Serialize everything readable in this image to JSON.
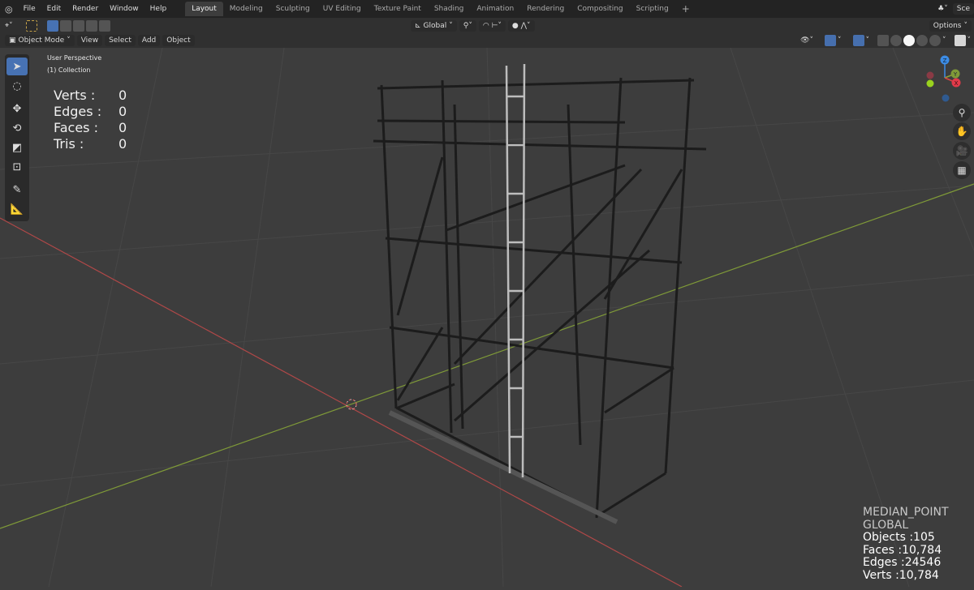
{
  "topbar": {
    "menus": [
      "File",
      "Edit",
      "Render",
      "Window",
      "Help"
    ],
    "workspaces": [
      "Layout",
      "Modeling",
      "Sculpting",
      "UV Editing",
      "Texture Paint",
      "Shading",
      "Animation",
      "Rendering",
      "Compositing",
      "Scripting"
    ],
    "add_tab": "+",
    "scene": "Sce"
  },
  "header": {
    "transform_orientation": "Global",
    "options": "Options"
  },
  "viewport_header": {
    "mode": "Object Mode",
    "menus": [
      "View",
      "Select",
      "Add",
      "Object"
    ]
  },
  "overlay": {
    "view_name": "User Perspective",
    "collection": "(1) Collection"
  },
  "stats": [
    {
      "label": "Verts :",
      "value": "0"
    },
    {
      "label": "Edges :",
      "value": "0"
    },
    {
      "label": "Faces :",
      "value": "0"
    },
    {
      "label": "Tris :",
      "value": "0"
    }
  ],
  "scene_info": {
    "pivot": "MEDIAN_POINT",
    "orientation": "GLOBAL",
    "objects": "Objects :105",
    "faces": "Faces :10,784",
    "edges": "Edges :24546",
    "verts": "Verts :10,784"
  },
  "gizmo": {
    "z": "Z",
    "y": "Y",
    "x": "X"
  },
  "colors": {
    "accent": "#4772b3",
    "x_axis": "#c24a4a",
    "y_axis": "#8aa33a",
    "z_axis": "#3c8ce6"
  }
}
